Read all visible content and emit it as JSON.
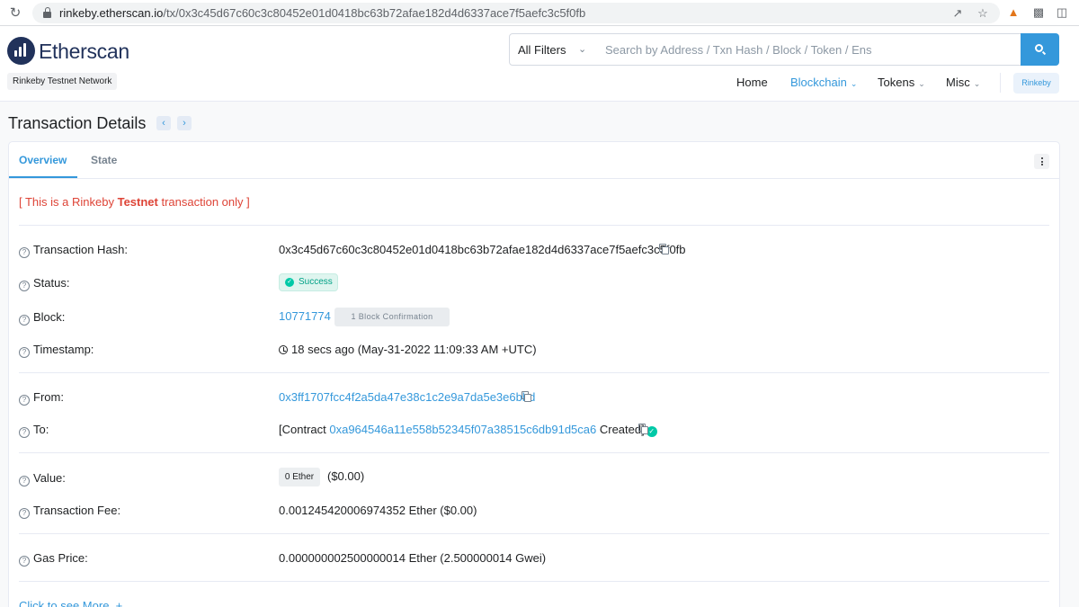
{
  "browser": {
    "url_host": "rinkeby.etherscan.io",
    "url_path": "/tx/0x3c45d67c60c3c80452e01d0418bc63b72afae182d4d6337ace7f5aefc3c5f0fb"
  },
  "header": {
    "logo_text": "Etherscan",
    "network_badge": "Rinkeby Testnet Network",
    "search": {
      "filter_label": "All Filters",
      "placeholder": "Search by Address / Txn Hash / Block / Token / Ens"
    },
    "nav": {
      "home": "Home",
      "blockchain": "Blockchain",
      "tokens": "Tokens",
      "misc": "Misc",
      "network_button": "Rinkeby"
    }
  },
  "page": {
    "title": "Transaction Details"
  },
  "tabs": {
    "overview": "Overview",
    "state": "State"
  },
  "notice": {
    "prefix": "[ This is a Rinkeby ",
    "emphasis": "Testnet",
    "suffix": " transaction only ]"
  },
  "details": {
    "tx_hash": {
      "label": "Transaction Hash:",
      "value": "0x3c45d67c60c3c80452e01d0418bc63b72afae182d4d6337ace7f5aefc3c5f0fb"
    },
    "status": {
      "label": "Status:",
      "value": "Success"
    },
    "block": {
      "label": "Block:",
      "value": "10771774",
      "confirmations": "1 Block Confirmation"
    },
    "timestamp": {
      "label": "Timestamp:",
      "value": "18 secs ago (May-31-2022 11:09:33 AM +UTC)"
    },
    "from": {
      "label": "From:",
      "value": "0x3ff1707fcc4f2a5da47e38c1c2e9a7da5e3e6bbd"
    },
    "to": {
      "label": "To:",
      "prefix": "[Contract ",
      "address": "0xa964546a11e558b52345f07a38515c6db91d5ca6",
      "suffix": " Created]"
    },
    "value": {
      "label": "Value:",
      "badge": "0 Ether",
      "usd": "($0.00)"
    },
    "fee": {
      "label": "Transaction Fee:",
      "value": "0.001245420006974352 Ether ($0.00)"
    },
    "gas_price": {
      "label": "Gas Price:",
      "value": "0.000000002500000014 Ether (2.500000014 Gwei)"
    }
  },
  "see_more": "Click to see More  +",
  "colors": {
    "accent": "#3498db",
    "success": "#00c9a7",
    "danger": "#de4437",
    "brand": "#21325b"
  }
}
